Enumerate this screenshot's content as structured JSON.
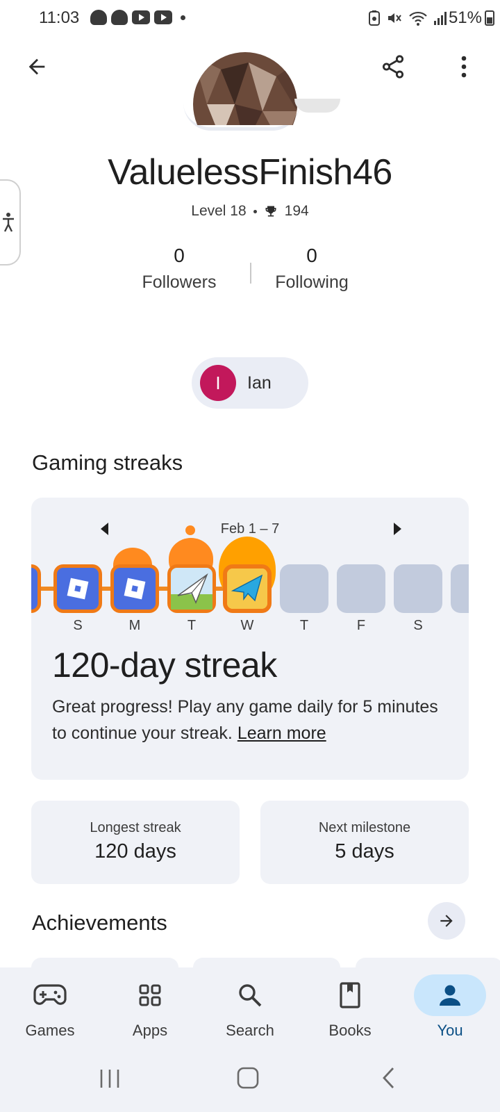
{
  "status_bar": {
    "time": "11:03",
    "battery": "51%"
  },
  "profile": {
    "username": "ValuelessFinish46",
    "level": "Level 18",
    "trophies": "194",
    "followers_count": "0",
    "followers_label": "Followers",
    "following_count": "0",
    "following_label": "Following"
  },
  "account_chip": {
    "initial": "I",
    "name": "Ian",
    "color": "#c2185b"
  },
  "streaks": {
    "section_title": "Gaming streaks",
    "week_label": "Feb 1 – 7",
    "days": [
      "S",
      "M",
      "T",
      "W",
      "T",
      "F",
      "S"
    ],
    "streak_title": "120-day streak",
    "description": "Great progress! Play any game daily for 5 minutes to continue your streak.",
    "learn_more": "Learn more",
    "accent_color": "#f07a16"
  },
  "stats": {
    "longest_label": "Longest streak",
    "longest_value": "120 days",
    "next_label": "Next milestone",
    "next_value": "5 days"
  },
  "achievements": {
    "title": "Achievements"
  },
  "bottom_nav": {
    "items": [
      {
        "label": "Games",
        "icon": "gamepad-icon"
      },
      {
        "label": "Apps",
        "icon": "apps-grid-icon"
      },
      {
        "label": "Search",
        "icon": "search-icon"
      },
      {
        "label": "Books",
        "icon": "book-icon"
      },
      {
        "label": "You",
        "icon": "person-icon"
      }
    ],
    "active": "You",
    "active_color": "#0b4f85"
  }
}
